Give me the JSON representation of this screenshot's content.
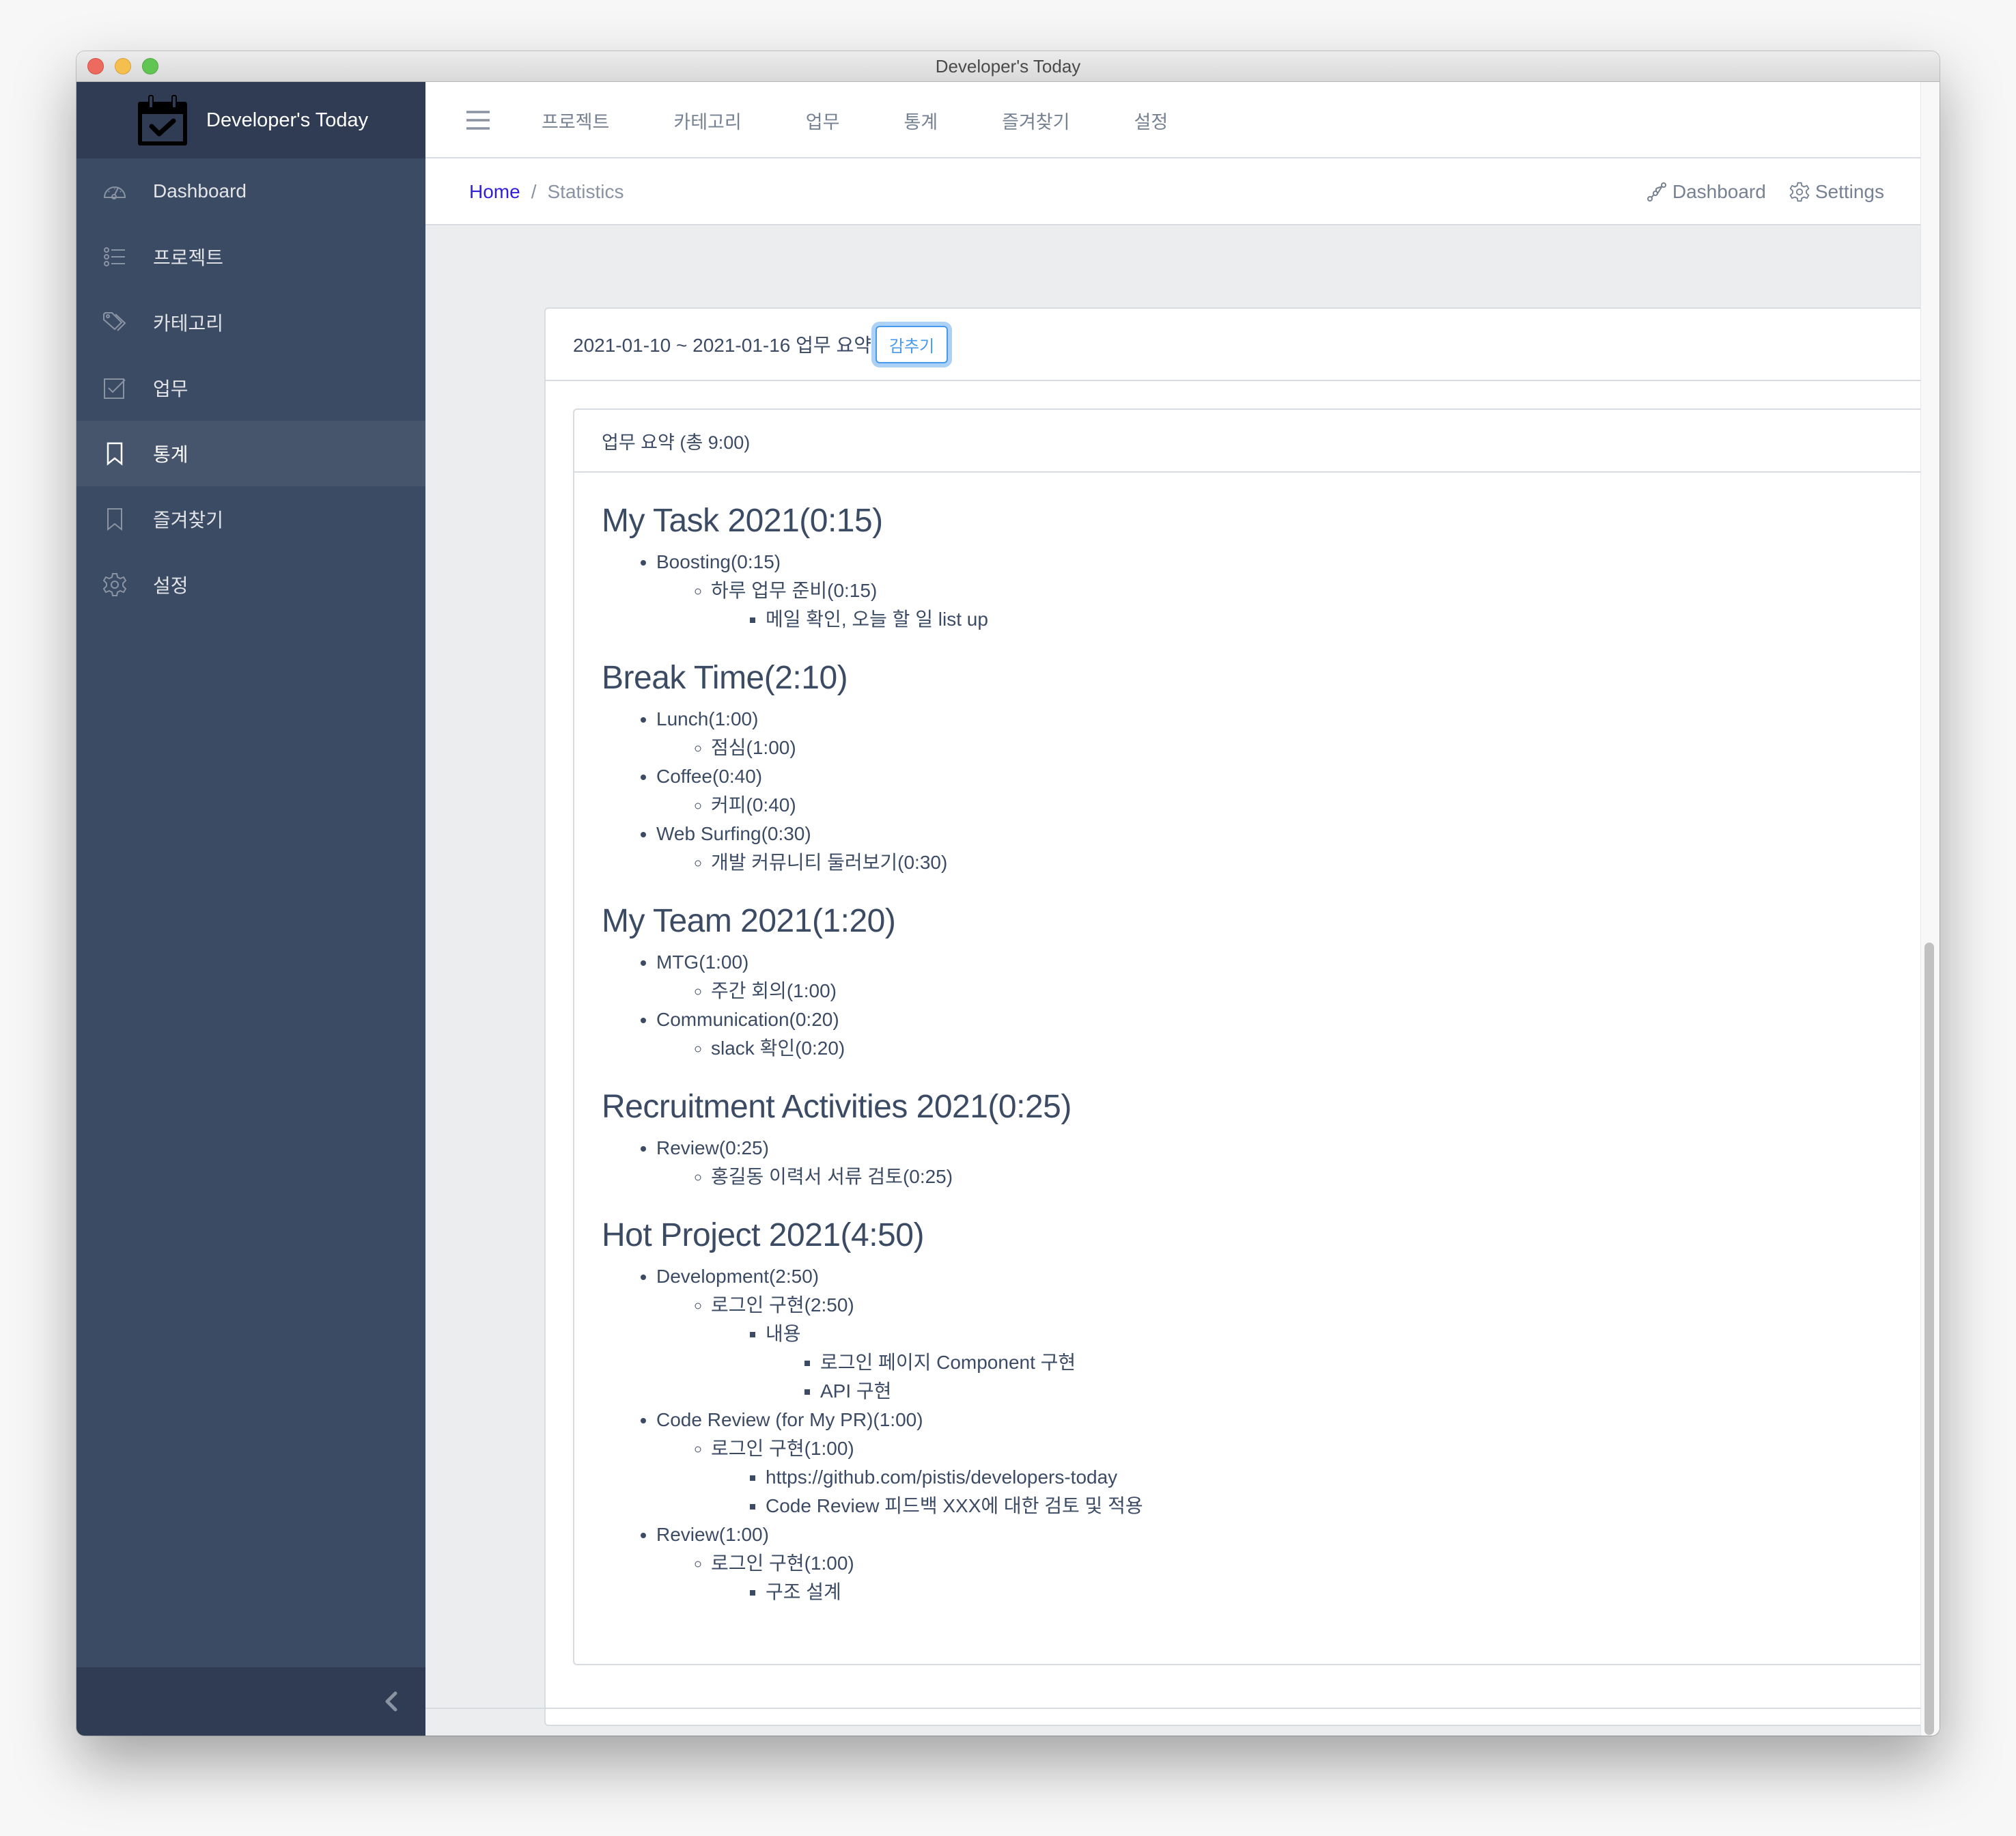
{
  "window": {
    "title": "Developer's Today"
  },
  "sidebar": {
    "brand": "Developer's Today",
    "items": [
      {
        "label": "Dashboard",
        "icon": "speedometer-icon",
        "active": false
      },
      {
        "label": "프로젝트",
        "icon": "list-icon",
        "active": false
      },
      {
        "label": "카테고리",
        "icon": "tags-icon",
        "active": false
      },
      {
        "label": "업무",
        "icon": "task-check-icon",
        "active": false
      },
      {
        "label": "통계",
        "icon": "bookmark-icon",
        "active": true
      },
      {
        "label": "즐겨찾기",
        "icon": "bookmark-icon",
        "active": false
      },
      {
        "label": "설정",
        "icon": "gear-icon",
        "active": false
      }
    ],
    "collapse_icon": "chevron-left-icon"
  },
  "header": {
    "menu_icon": "hamburger-icon",
    "nav": [
      "프로젝트",
      "카테고리",
      "업무",
      "통계",
      "즐겨찾기",
      "설정"
    ]
  },
  "breadcrumb": {
    "home": "Home",
    "separator": "/",
    "current": "Statistics"
  },
  "subheader_actions": {
    "dashboard": "Dashboard",
    "settings": "Settings"
  },
  "summary": {
    "period_title": "2021-01-10 ~ 2021-01-16 업무 요약",
    "hide_button": "감추기",
    "card_title": "업무 요약 (총 9:00)",
    "sections": [
      {
        "title": "My Task 2021(0:15)",
        "items": [
          {
            "label": "Boosting(0:15)",
            "children": [
              {
                "label": "하루 업무 준비(0:15)",
                "children": [
                  {
                    "label": "메일 확인, 오늘 할 일 list up"
                  }
                ]
              }
            ]
          }
        ]
      },
      {
        "title": "Break Time(2:10)",
        "items": [
          {
            "label": "Lunch(1:00)",
            "children": [
              {
                "label": "점심(1:00)"
              }
            ]
          },
          {
            "label": "Coffee(0:40)",
            "children": [
              {
                "label": "커피(0:40)"
              }
            ]
          },
          {
            "label": "Web Surfing(0:30)",
            "children": [
              {
                "label": "개발 커뮤니티 둘러보기(0:30)"
              }
            ]
          }
        ]
      },
      {
        "title": "My Team 2021(1:20)",
        "items": [
          {
            "label": "MTG(1:00)",
            "children": [
              {
                "label": "주간 회의(1:00)"
              }
            ]
          },
          {
            "label": "Communication(0:20)",
            "children": [
              {
                "label": "slack 확인(0:20)"
              }
            ]
          }
        ]
      },
      {
        "title": "Recruitment Activities 2021(0:25)",
        "items": [
          {
            "label": "Review(0:25)",
            "children": [
              {
                "label": "홍길동 이력서 서류 검토(0:25)"
              }
            ]
          }
        ]
      },
      {
        "title": "Hot Project 2021(4:50)",
        "items": [
          {
            "label": "Development(2:50)",
            "children": [
              {
                "label": "로그인 구현(2:50)",
                "children": [
                  {
                    "label": "내용",
                    "children": [
                      {
                        "label": "로그인 페이지 Component 구현"
                      },
                      {
                        "label": "API 구현"
                      }
                    ]
                  }
                ]
              }
            ]
          },
          {
            "label": "Code Review (for My PR)(1:00)",
            "children": [
              {
                "label": "로그인 구현(1:00)",
                "children": [
                  {
                    "label": "https://github.com/pistis/developers-today"
                  },
                  {
                    "label": "Code Review 피드백 XXX에 대한 검토 및 적용"
                  }
                ]
              }
            ]
          },
          {
            "label": "Review(1:00)",
            "children": [
              {
                "label": "로그인 구현(1:00)",
                "children": [
                  {
                    "label": "구조 설계"
                  }
                ]
              }
            ]
          }
        ]
      }
    ]
  },
  "colors": {
    "sidebar_bg": "#3c4b64",
    "sidebar_brand_bg": "#303c54",
    "sidebar_active_bg": "#46546c",
    "link": "#321fdb",
    "text": "#3c4b64",
    "muted": "#768192",
    "button_accent": "#4799eb"
  }
}
